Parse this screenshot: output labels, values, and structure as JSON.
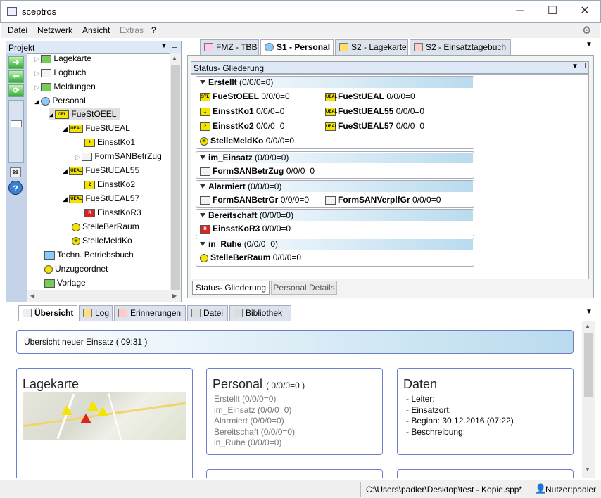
{
  "window": {
    "title": "sceptros",
    "minimize": "─",
    "maximize": "☐",
    "close": "✕"
  },
  "menu": [
    "Datei",
    "Netzwerk",
    "Ansicht",
    "Extras",
    "?"
  ],
  "project": {
    "title": "Projekt",
    "pin": "⊥",
    "tree": [
      {
        "label": "Lagekarte"
      },
      {
        "label": "Logbuch"
      },
      {
        "label": "Meldungen"
      },
      {
        "label": "Personal"
      },
      {
        "label": "FueStOEEL"
      },
      {
        "label": "FueStUEAL"
      },
      {
        "label": "EinsstKo1"
      },
      {
        "label": "FormSANBetrZug"
      },
      {
        "label": "FueStUEAL55"
      },
      {
        "label": "EinsstKo2"
      },
      {
        "label": "FueStUEAL57"
      },
      {
        "label": "EinsstKoR3"
      },
      {
        "label": "StelleBerRaum"
      },
      {
        "label": "StelleMeldKo"
      },
      {
        "label": "Techn. Betriebsbuch"
      },
      {
        "label": "Unzugeordnet"
      },
      {
        "label": "Vorlage"
      }
    ]
  },
  "tabs": [
    "FMZ - TBB",
    "S1 - Personal",
    "S2 - Lagekarte",
    "S2 - Einsatztagebuch"
  ],
  "status_panel": {
    "title": "Status- Gliederung",
    "groups": [
      {
        "name": "Erstellt",
        "count": "(0/0/0=0)",
        "items": [
          {
            "label": "FueStOEEL",
            "val": "0/0/0=0"
          },
          {
            "label": "FueStUEAL",
            "val": "0/0/0=0"
          },
          {
            "label": "EinsstKo1",
            "val": "0/0/0=0"
          },
          {
            "label": "FueStUEAL55",
            "val": "0/0/0=0"
          },
          {
            "label": "EinsstKo2",
            "val": "0/0/0=0"
          },
          {
            "label": "FueStUEAL57",
            "val": "0/0/0=0"
          },
          {
            "label": "StelleMeldKo",
            "val": "0/0/0=0"
          }
        ]
      },
      {
        "name": "im_Einsatz",
        "count": "(0/0/0=0)",
        "items": [
          {
            "label": "FormSANBetrZug",
            "val": "0/0/0=0"
          }
        ]
      },
      {
        "name": "Alarmiert",
        "count": "(0/0/0=0)",
        "items": [
          {
            "label": "FormSANBetrGr",
            "val": "0/0/0=0"
          },
          {
            "label": "FormSANVerplfGr",
            "val": "0/0/0=0"
          }
        ]
      },
      {
        "name": "Bereitschaft",
        "count": "(0/0/0=0)",
        "items": [
          {
            "label": "EinsstKoR3",
            "val": "0/0/0=0"
          }
        ]
      },
      {
        "name": "in_Ruhe",
        "count": "(0/0/0=0)",
        "items": [
          {
            "label": "StelleBerRaum",
            "val": "0/0/0=0"
          }
        ]
      }
    ],
    "subtabs": [
      "Status- Gliederung",
      "Personal Details"
    ]
  },
  "bottom_tabs": [
    "Übersicht",
    "Log",
    "Erinnerungen",
    "Datei",
    "Bibliothek"
  ],
  "overview": {
    "header": "Übersicht neuer Einsatz  ( 09:31 )",
    "lagekarte": {
      "title": "Lagekarte"
    },
    "personal": {
      "title": "Personal",
      "count": "( 0/0/0=0 )",
      "lines": [
        "Erstellt (0/0/0=0)",
        "im_Einsatz (0/0/0=0)",
        "Alarmiert (0/0/0=0)",
        "Bereitschaft (0/0/0=0)",
        "in_Ruhe (0/0/0=0)"
      ]
    },
    "daten": {
      "title": "Daten",
      "lines": [
        "- Leiter:",
        "- Einsatzort:",
        "- Beginn:  30.12.2016 (07:22)",
        "- Beschreibung:"
      ]
    }
  },
  "statusbar": {
    "path": "C:\\Users\\padler\\Desktop\\test - Kopie.spp*",
    "user": "Nutzer:padler"
  },
  "icon_text": {
    "oeel": "OEL",
    "ueal": "UEAL",
    "ko1": "1",
    "ko2": "2",
    "m": "M",
    "r3": "R",
    "stl": "STL"
  }
}
